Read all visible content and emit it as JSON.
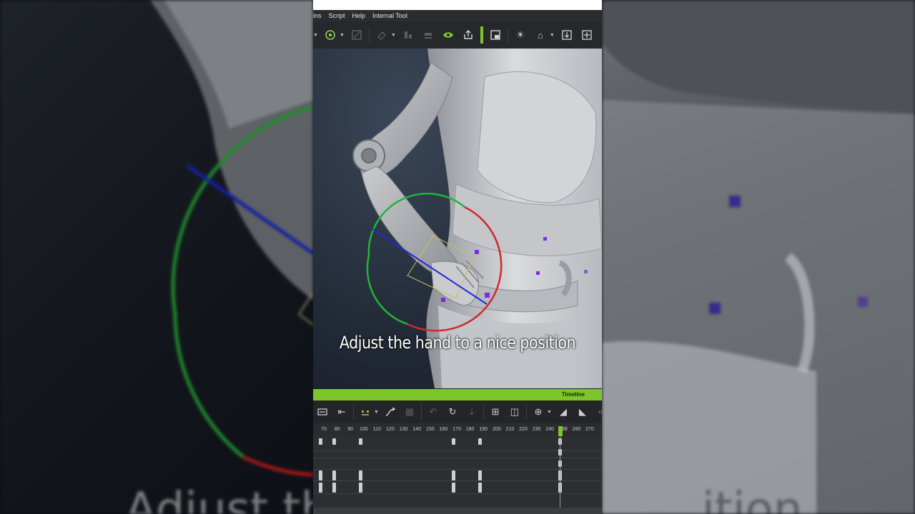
{
  "menu": [
    "ins",
    "Script",
    "Help",
    "Internal Tool"
  ],
  "toolbar_icons": [
    "gizmo-dropdown-icon",
    "rotate-icon",
    "scale-icon",
    "eraser-icon",
    "align-icon",
    "align2-icon",
    "eye-icon",
    "export-icon",
    "viewport-icon",
    "light-icon",
    "home-icon",
    "fit-icon",
    "frame-icon"
  ],
  "caption": "Adjust the hand to a nice position",
  "timeline": {
    "title": "Timeline",
    "ticks": [
      "70",
      "80",
      "90",
      "100",
      "110",
      "120",
      "130",
      "140",
      "150",
      "160",
      "170",
      "180",
      "190",
      "200",
      "210",
      "220",
      "230",
      "240",
      "250",
      "260",
      "270",
      "2"
    ],
    "current_frame": "250"
  },
  "colors": {
    "accent": "#7cc62a",
    "gizmo_red": "#d0282c",
    "gizmo_green": "#22b43a",
    "gizmo_blue": "#1e2bd6",
    "control_point": "#7a2ee0"
  }
}
